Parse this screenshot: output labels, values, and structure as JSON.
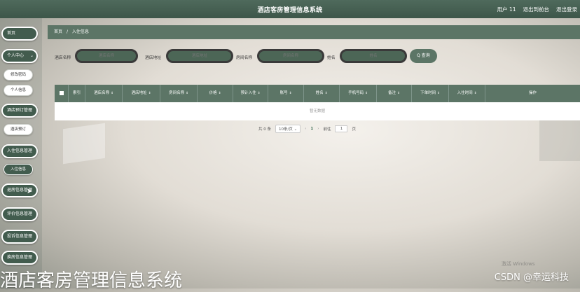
{
  "header": {
    "title": "酒店客房管理信息系统",
    "links": [
      "用户 11",
      "退出到前台",
      "退出登录"
    ]
  },
  "sidebar": {
    "items": [
      {
        "label": "首页",
        "type": "main"
      },
      {
        "label": "个人中心",
        "type": "main",
        "chevron": "⌄"
      },
      {
        "label": "修改密码",
        "type": "sub"
      },
      {
        "label": "个人信息",
        "type": "sub"
      },
      {
        "label": "酒店预订管理",
        "type": "main"
      },
      {
        "label": "酒店预订",
        "type": "sub"
      },
      {
        "label": "入住信息管理",
        "type": "main"
      },
      {
        "label": "入住信息",
        "type": "sub-dark"
      },
      {
        "label": "退房信息管理",
        "type": "main"
      },
      {
        "label": "评价信息管理",
        "type": "main"
      },
      {
        "label": "投诉信息管理",
        "type": "main"
      },
      {
        "label": "换房信息管理",
        "type": "main"
      }
    ]
  },
  "breadcrumb": {
    "home": "首页",
    "separator": "/",
    "current": "入住信息"
  },
  "search": {
    "fields": [
      {
        "label": "酒店名称",
        "placeholder": "酒店名称"
      },
      {
        "label": "酒店地址",
        "placeholder": "酒店地址"
      },
      {
        "label": "房间名称",
        "placeholder": "房间名称"
      },
      {
        "label": "姓名",
        "placeholder": "姓名"
      }
    ],
    "button_label": "Q 查询"
  },
  "table": {
    "columns": [
      "索引",
      "酒店名称",
      "酒店地址",
      "房间名称",
      "价格",
      "预计入住",
      "账号",
      "姓名",
      "手机号码",
      "备注",
      "下单时间",
      "入住时间",
      "操作"
    ],
    "sortable": [
      false,
      true,
      true,
      true,
      true,
      true,
      true,
      true,
      true,
      true,
      true,
      true,
      false
    ],
    "sort_icon": "⇕",
    "empty_text": "暂无数据"
  },
  "pagination": {
    "total": "共 0 条",
    "page_size": "10条/页",
    "size_chevron": "⌄",
    "prev": "‹",
    "current": "1",
    "next": "›",
    "goto_label": "前往",
    "goto_value": "1",
    "page_unit": "页"
  },
  "overlay": {
    "title": "酒店客房管理信息系统",
    "csdn": "CSDN @幸运科技",
    "windows_watermark": "激活 Windows"
  },
  "colors": {
    "primary": "#5c7566",
    "sidebar": "#425c4e",
    "header": "#4f6a5c"
  }
}
